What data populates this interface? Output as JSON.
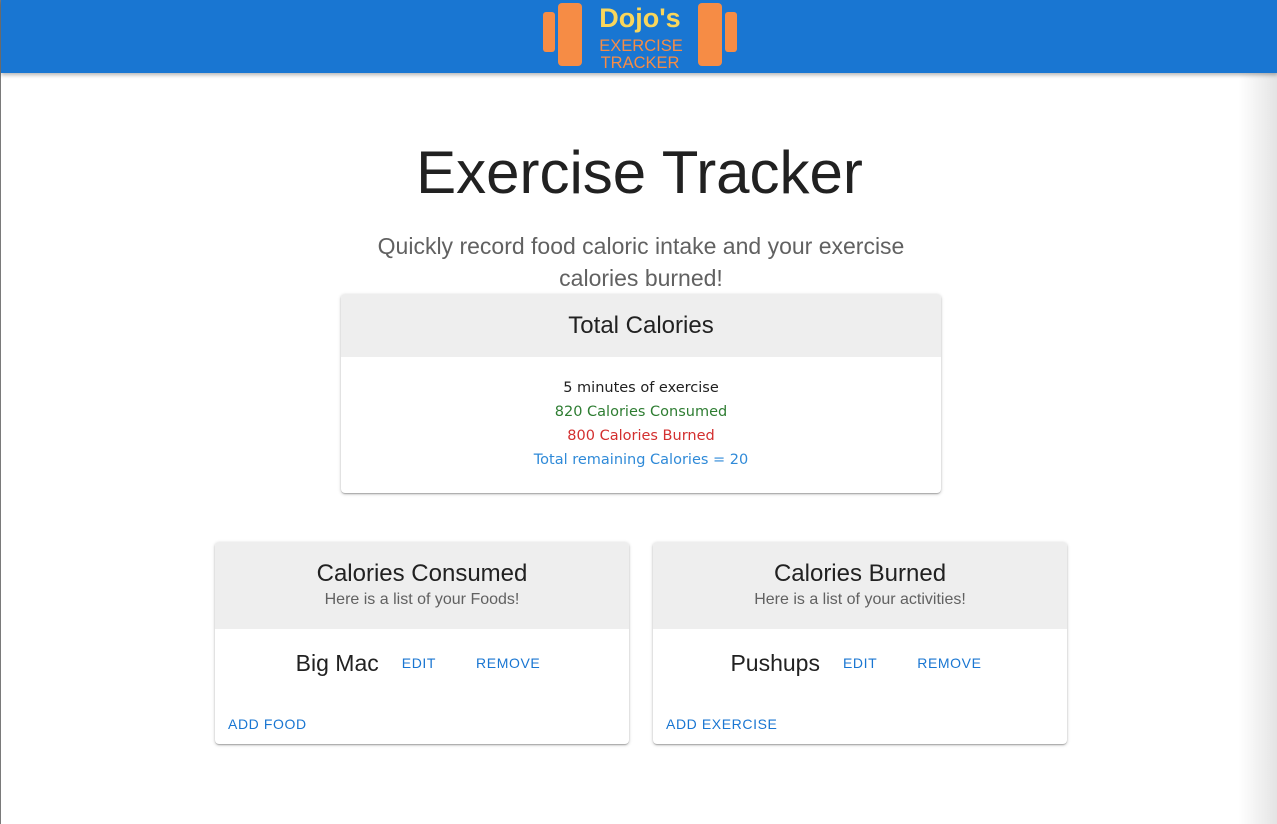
{
  "header": {
    "logo": {
      "line1": "Dojo's",
      "line2": "EXERCISE",
      "line3": "TRACKER",
      "icon": "dumbbell-icon",
      "color": "#f68c45",
      "accent": "#f9d65c"
    },
    "bar_color": "#1976d2"
  },
  "main": {
    "title": "Exercise Tracker",
    "subtitle": "Quickly record food caloric intake and your exercise calories burned!"
  },
  "totals": {
    "title": "Total Calories",
    "minutes": "5 minutes of exercise",
    "consumed": "820 Calories Consumed",
    "burned": "800 Calories Burned",
    "remaining": "Total remaining Calories = 20"
  },
  "consumed_card": {
    "title": "Calories Consumed",
    "subtitle": "Here is a list of your Foods!",
    "items": [
      {
        "name": "Big Mac",
        "edit": "EDIT",
        "remove": "REMOVE"
      }
    ],
    "add_label": "ADD FOOD"
  },
  "burned_card": {
    "title": "Calories Burned",
    "subtitle": "Here is a list of your activities!",
    "items": [
      {
        "name": "Pushups",
        "edit": "EDIT",
        "remove": "REMOVE"
      }
    ],
    "add_label": "ADD EXERCISE"
  }
}
